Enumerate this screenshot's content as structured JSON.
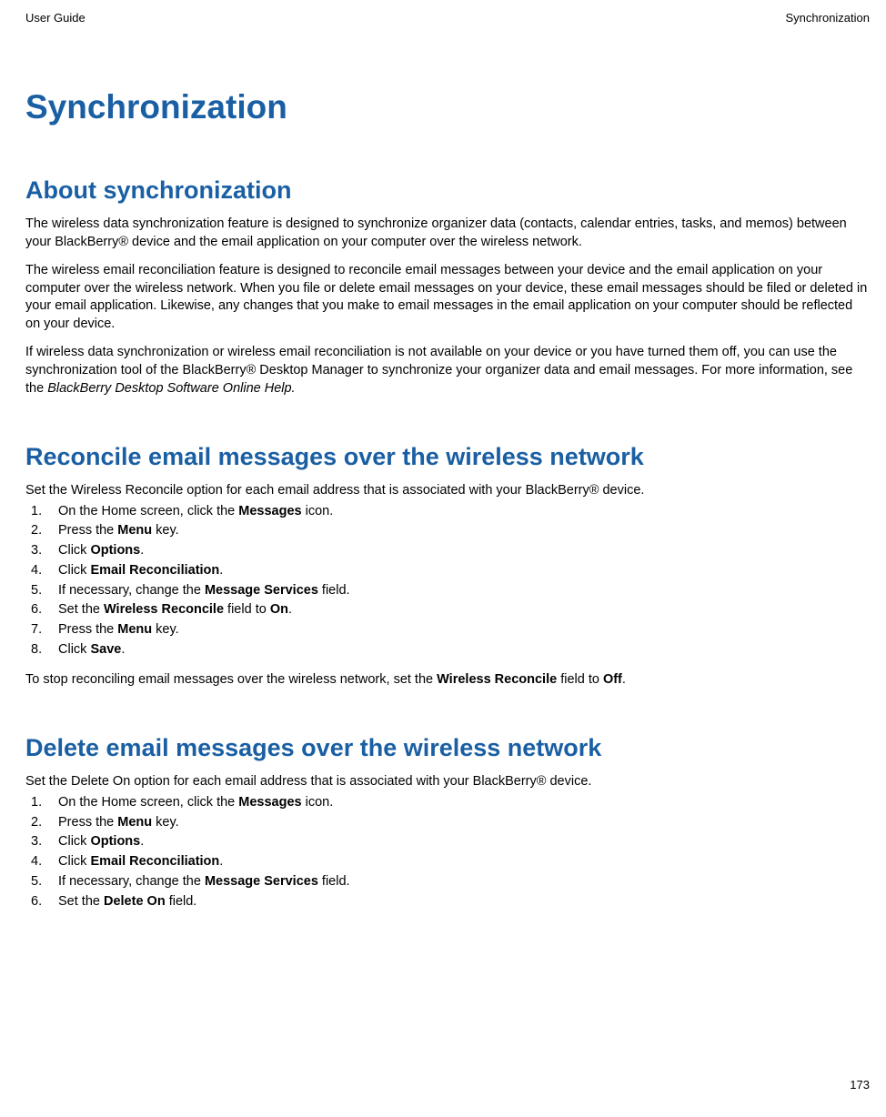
{
  "header": {
    "left": "User Guide",
    "right": "Synchronization"
  },
  "page_title": "Synchronization",
  "sections": {
    "about": {
      "heading": "About synchronization",
      "para1": "The wireless data synchronization feature is designed to synchronize organizer data (contacts, calendar entries, tasks, and memos) between your BlackBerry® device and the email application on your computer over the wireless network.",
      "para2": "The wireless email reconciliation feature is designed to reconcile email messages between your device and the email application on your computer over the wireless network. When you file or delete email messages on your device, these email messages should be filed or deleted in your email application. Likewise, any changes that you make to email messages in the email application on your computer should be reflected on your device.",
      "para3_prefix": "If wireless data synchronization or wireless email reconciliation is not available on your device or you have turned them off, you can use the synchronization tool of the BlackBerry® Desktop Manager to synchronize your organizer data and email messages. For more information, see the  ",
      "para3_italic": "BlackBerry Desktop Software Online Help."
    },
    "reconcile": {
      "heading": "Reconcile email messages over the wireless network",
      "intro": "Set the Wireless Reconcile option for each email address that is associated with your BlackBerry® device.",
      "steps": [
        {
          "pre": "On the Home screen, click the ",
          "bold": "Messages",
          "post": " icon."
        },
        {
          "pre": "Press the ",
          "bold": "Menu",
          "post": " key."
        },
        {
          "pre": "Click ",
          "bold": "Options",
          "post": "."
        },
        {
          "pre": "Click ",
          "bold": "Email Reconciliation",
          "post": "."
        },
        {
          "pre": "If necessary, change the ",
          "bold": "Message Services",
          "post": " field."
        },
        {
          "pre": "Set the ",
          "bold": "Wireless Reconcile",
          "post": " field to ",
          "bold2": "On",
          "post2": "."
        },
        {
          "pre": "Press the ",
          "bold": "Menu",
          "post": " key."
        },
        {
          "pre": "Click ",
          "bold": "Save",
          "post": "."
        }
      ],
      "outro_pre": "To stop reconciling email messages over the wireless network, set the ",
      "outro_bold": "Wireless Reconcile",
      "outro_mid": " field to ",
      "outro_bold2": "Off",
      "outro_post": "."
    },
    "delete": {
      "heading": "Delete email messages over the wireless network",
      "intro": "Set the Delete On option for each email address that is associated with your BlackBerry® device.",
      "steps": [
        {
          "pre": "On the Home screen, click the ",
          "bold": "Messages",
          "post": " icon."
        },
        {
          "pre": "Press the ",
          "bold": "Menu",
          "post": " key."
        },
        {
          "pre": "Click ",
          "bold": "Options",
          "post": "."
        },
        {
          "pre": "Click ",
          "bold": "Email Reconciliation",
          "post": "."
        },
        {
          "pre": "If necessary, change the ",
          "bold": "Message Services",
          "post": " field."
        },
        {
          "pre": "Set the ",
          "bold": "Delete On",
          "post": " field."
        }
      ]
    }
  },
  "page_number": "173"
}
